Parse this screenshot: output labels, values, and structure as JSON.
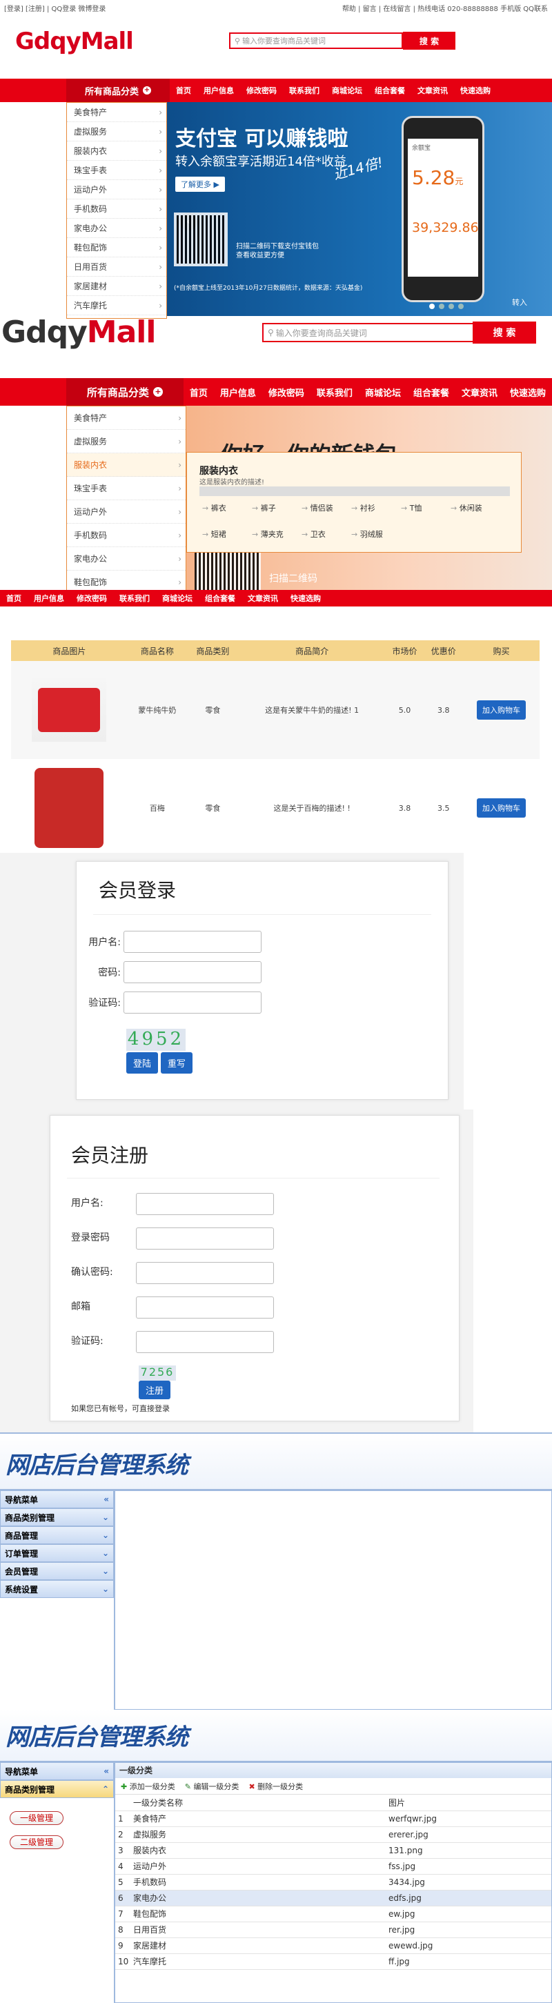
{
  "topbar": {
    "left": "[登录] [注册] | QQ登录 微博登录",
    "right": "帮助 | 留言 | 在线留言 | 热线电话 020-88888888 手机版 QQ联系"
  },
  "header": {
    "logo_main": "Gdqy",
    "logo_sub": "Mall",
    "search_placeholder": "输入你要查询商品关键词",
    "search_button": "搜 索"
  },
  "nav": {
    "all_label": "所有商品分类",
    "items": [
      "首页",
      "用户信息",
      "修改密码",
      "联系我们",
      "商城论坛",
      "组合套餐",
      "文章资讯",
      "快速选购"
    ]
  },
  "categories": [
    "美食特产",
    "虚拟服务",
    "服装内衣",
    "珠宝手表",
    "运动户外",
    "手机数码",
    "家电办公",
    "鞋包配饰",
    "日用百货",
    "家居建材",
    "汽车摩托"
  ],
  "banner": {
    "title": "支付宝 可以赚钱啦",
    "subtitle": "转入余额宝享活期近14倍*收益",
    "more": "了解更多 ▶",
    "qr_text1": "扫描二维码下载支付宝钱包",
    "qr_text2": "查看收益更方便",
    "footnote": "(*自余额宝上线至2013年10月27日数据统计，数据来源：天弘基金)",
    "phone_v1": "5.28",
    "phone_unit": "元",
    "phone_v2": "39,329.86",
    "phone_label": "余额宝",
    "handwrite": "近14倍!",
    "join": "转入"
  },
  "dropdown": {
    "title": "服装内衣",
    "desc": "这是服装内衣的描述!",
    "items": [
      "裤衣",
      "裤子",
      "情侣装",
      "衬衫",
      "T恤",
      "休闲装",
      "短裙",
      "薄夹克",
      "卫衣",
      "羽绒服"
    ],
    "banner_text": "你好，你的新钱包",
    "qr_text": "扫描二维码"
  },
  "red_nav": [
    "首页",
    "用户信息",
    "修改密码",
    "联系我们",
    "商城论坛",
    "组合套餐",
    "文章资讯",
    "快速选购"
  ],
  "products": {
    "headers": [
      "商品图片",
      "商品名称",
      "商品类别",
      "商品简介",
      "市场价",
      "优惠价",
      "购买"
    ],
    "rows": [
      {
        "name": "蒙牛纯牛奶",
        "cat": "零食",
        "desc": "这是有关蒙牛牛奶的描述! 1",
        "mp": "5.0",
        "pp": "3.8",
        "buy": "加入购物车"
      },
      {
        "name": "百梅",
        "cat": "零食",
        "desc": "这是关于百梅的描述! !",
        "mp": "3.8",
        "pp": "3.5",
        "buy": "加入购物车"
      }
    ]
  },
  "login": {
    "title": "会员登录",
    "user": "用户名:",
    "pwd": "密码:",
    "code": "验证码:",
    "captcha": "4952",
    "login": "登陆",
    "reset": "重写"
  },
  "register": {
    "title": "会员注册",
    "user": "用户名:",
    "pwd": "登录密码",
    "pwd2": "确认密码:",
    "mail": "邮箱",
    "code": "验证码:",
    "captcha": "7256",
    "submit": "注册",
    "note": "如果您已有帐号，可直接登录"
  },
  "admin": {
    "title": "网店后台管理系统",
    "menu": [
      "导航菜单",
      "商品类别管理",
      "商品管理",
      "订单管理",
      "会员管理",
      "系统设置"
    ]
  },
  "admin2": {
    "title": "网店后台管理系统",
    "menu_head": "导航菜单",
    "menu_active": "商品类别管理",
    "btn1": "一级管理",
    "btn2": "二级管理",
    "panel_title": "一级分类",
    "toolbar": [
      "添加一级分类",
      "编辑一级分类",
      "删除一级分类"
    ],
    "col1": "一级分类名称",
    "col2": "图片",
    "rows": [
      [
        "1",
        "美食特产",
        "werfqwr.jpg"
      ],
      [
        "2",
        "虚拟服务",
        "ererer.jpg"
      ],
      [
        "3",
        "服装内衣",
        "131.png"
      ],
      [
        "4",
        "运动户外",
        "fss.jpg"
      ],
      [
        "5",
        "手机数码",
        "3434.jpg"
      ],
      [
        "6",
        "家电办公",
        "edfs.jpg"
      ],
      [
        "7",
        "鞋包配饰",
        "ew.jpg"
      ],
      [
        "8",
        "日用百货",
        "rer.jpg"
      ],
      [
        "9",
        "家居建材",
        "ewewd.jpg"
      ],
      [
        "10",
        "汽车摩托",
        "ff.jpg"
      ]
    ]
  }
}
